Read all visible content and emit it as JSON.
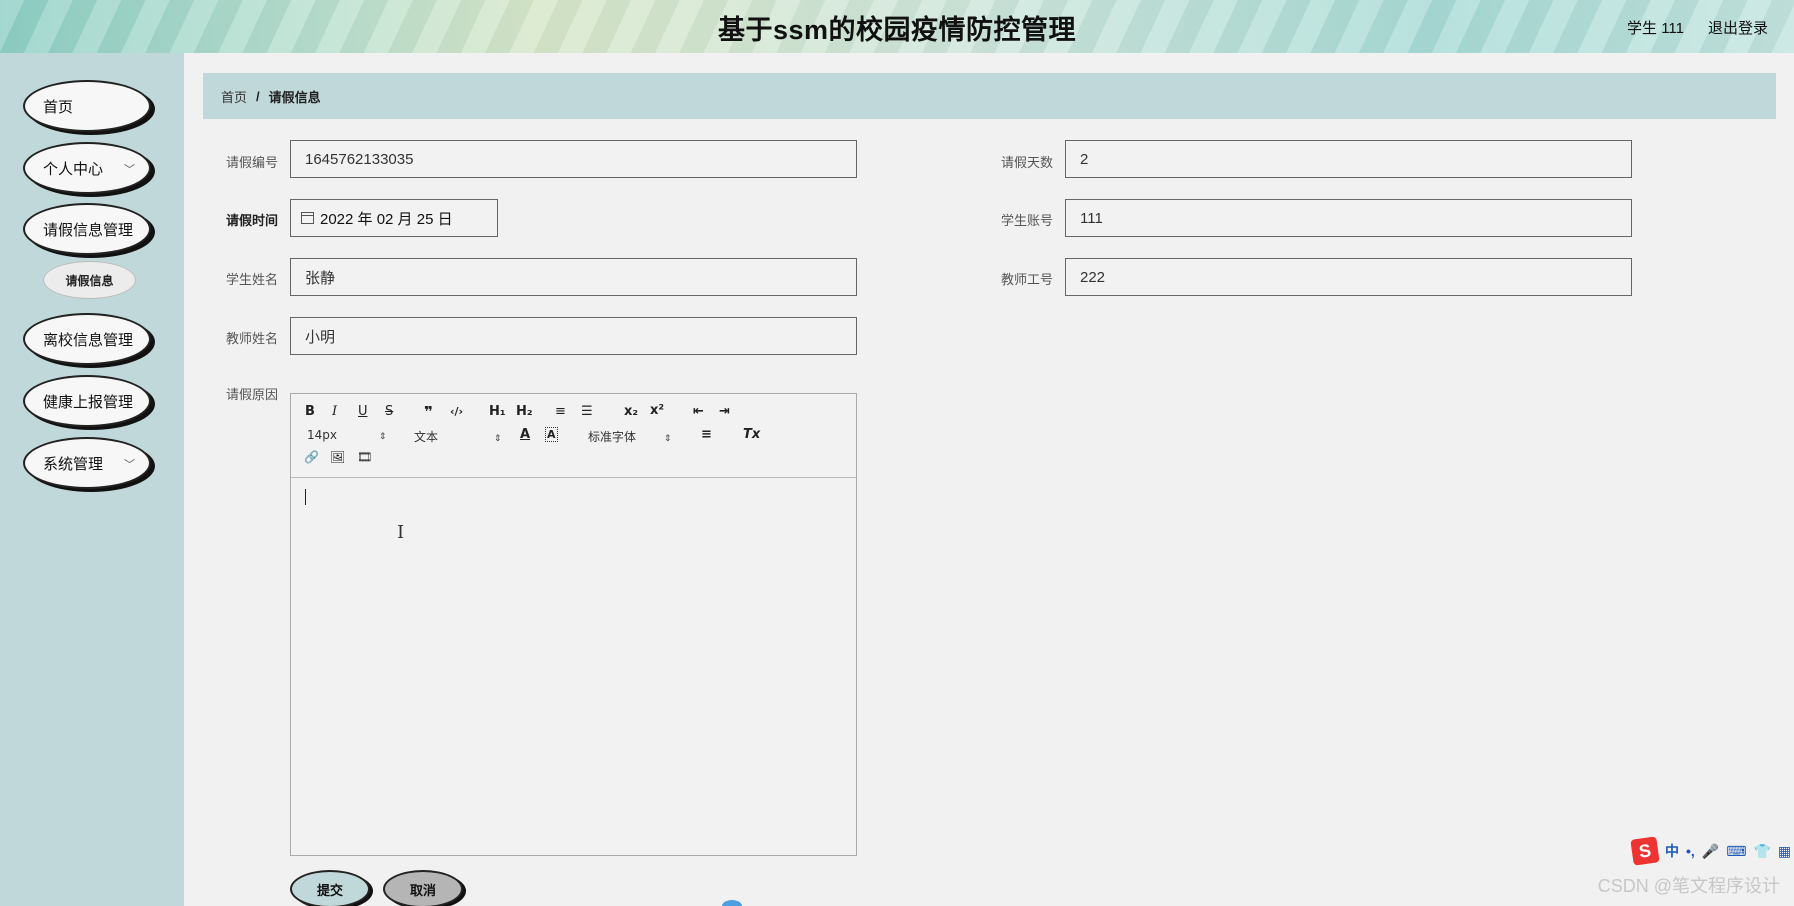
{
  "header": {
    "title": "基于ssm的校园疫情防控管理",
    "user": "学生 111",
    "logout": "退出登录"
  },
  "sidebar": {
    "items": [
      {
        "label": "首页"
      },
      {
        "label": "个人中心",
        "chevron": "﹀"
      },
      {
        "label": "请假信息管理"
      },
      {
        "label": "离校信息管理"
      },
      {
        "label": "健康上报管理"
      },
      {
        "label": "系统管理",
        "chevron": "﹀"
      }
    ],
    "sub_item": "请假信息"
  },
  "breadcrumb": {
    "home": "首页",
    "sep": "/",
    "current": "请假信息"
  },
  "form": {
    "leave_id_label": "请假编号",
    "leave_id": "1645762133035",
    "leave_days_label": "请假天数",
    "leave_days": "2",
    "leave_time_label": "请假时间",
    "leave_time": "2022 年 02 月 25 日",
    "student_account_label": "学生账号",
    "student_account": "111",
    "student_name_label": "学生姓名",
    "student_name": "张静",
    "teacher_id_label": "教师工号",
    "teacher_id": "222",
    "teacher_name_label": "教师姓名",
    "teacher_name": "小明",
    "reason_label": "请假原因"
  },
  "editor": {
    "font_size": "14px",
    "block_type": "文本",
    "font_family": "标准字体",
    "icons": {
      "bold": "B",
      "italic": "I",
      "underline": "U",
      "strike": "S",
      "quote": "❞",
      "code": "‹/›",
      "h1": "H₁",
      "h2": "H₂",
      "ol": "≡",
      "ul": "☰",
      "sub": "x₂",
      "sup": "x²",
      "outdent": "⇤",
      "indent": "⇥",
      "color": "A",
      "bg": "A",
      "align": "≡",
      "clear": "Tx",
      "link": "🔗",
      "image": "🖼",
      "video": "🎞",
      "select_arrow": "⇕"
    },
    "cursor": "I"
  },
  "buttons": {
    "submit": "提交",
    "cancel": "取消"
  },
  "ime": {
    "logo": "S",
    "lang": "中",
    "punct": "•,",
    "mic": "🎤",
    "keyboard": "⌨",
    "skin": "👕",
    "menu": "▦"
  },
  "watermark": "CSDN @笔文程序设计"
}
